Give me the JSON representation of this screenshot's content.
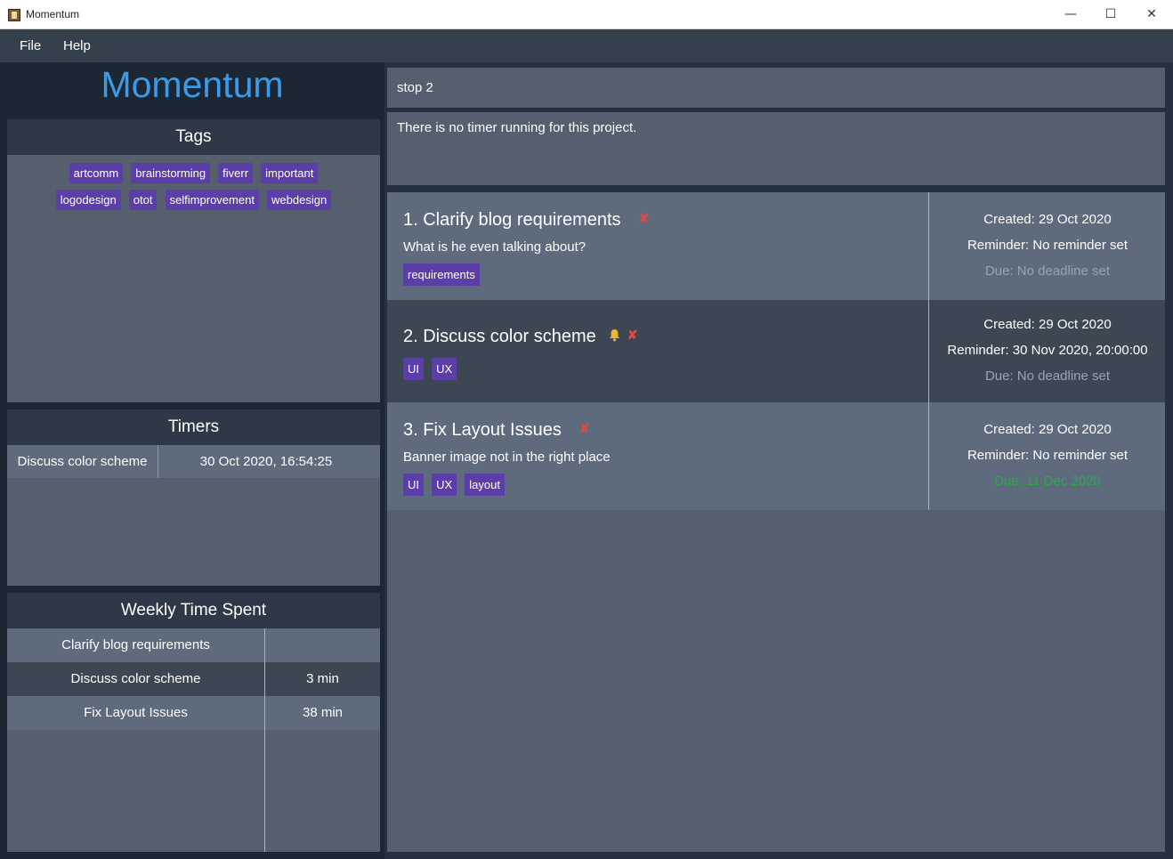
{
  "window": {
    "title": "Momentum",
    "minimize_label": "—",
    "maximize_label": "☐",
    "close_label": "✕"
  },
  "menu": {
    "file": "File",
    "help": "Help"
  },
  "sidebar": {
    "app_name": "Momentum",
    "tags_panel": {
      "title": "Tags",
      "rows": [
        [
          "artcomm",
          "brainstorming",
          "fiverr",
          "important"
        ],
        [
          "logodesign",
          "otot",
          "selfimprovement",
          "webdesign"
        ]
      ]
    },
    "timers_panel": {
      "title": "Timers",
      "rows": [
        {
          "project": "Discuss color scheme",
          "started": "30 Oct 2020, 16:54:25"
        }
      ]
    },
    "weekly_panel": {
      "title": "Weekly Time Spent",
      "rows": [
        {
          "project": "Clarify blog requirements",
          "time": ""
        },
        {
          "project": "Discuss color scheme",
          "time": "3 min"
        },
        {
          "project": "Fix Layout Issues",
          "time": "38 min"
        }
      ]
    }
  },
  "command": {
    "value": "stop 2"
  },
  "result": {
    "text": "There is no timer running for this project."
  },
  "projects": [
    {
      "title": "1. Clarify blog requirements",
      "description": "What is he even talking about?",
      "tags": [
        "requirements"
      ],
      "created": "Created: 29 Oct 2020",
      "reminder": "Reminder: No reminder set",
      "due": "Due: No deadline set",
      "has_reminder_icon": false
    },
    {
      "title": "2. Discuss color scheme",
      "description": "",
      "tags": [
        "UI",
        "UX"
      ],
      "created": "Created: 29 Oct 2020",
      "reminder": "Reminder: 30 Nov 2020, 20:00:00",
      "due": "Due: No deadline set",
      "has_reminder_icon": true
    },
    {
      "title": "3. Fix Layout Issues",
      "description": "Banner image not in the right place",
      "tags": [
        "UI",
        "UX",
        "layout"
      ],
      "created": "Created: 29 Oct 2020",
      "reminder": "Reminder: No reminder set",
      "due": "Due: 11 Dec 2020",
      "has_reminder_icon": false
    }
  ],
  "icons": {
    "delete": "x-icon",
    "reminder": "bell-icon",
    "app": "app-icon"
  },
  "colors": {
    "accent": "#3a9be8",
    "tag": "#5b3ea8",
    "delete": "#e04848",
    "bell": "#f0b429",
    "due_ok": "#29a84c"
  }
}
